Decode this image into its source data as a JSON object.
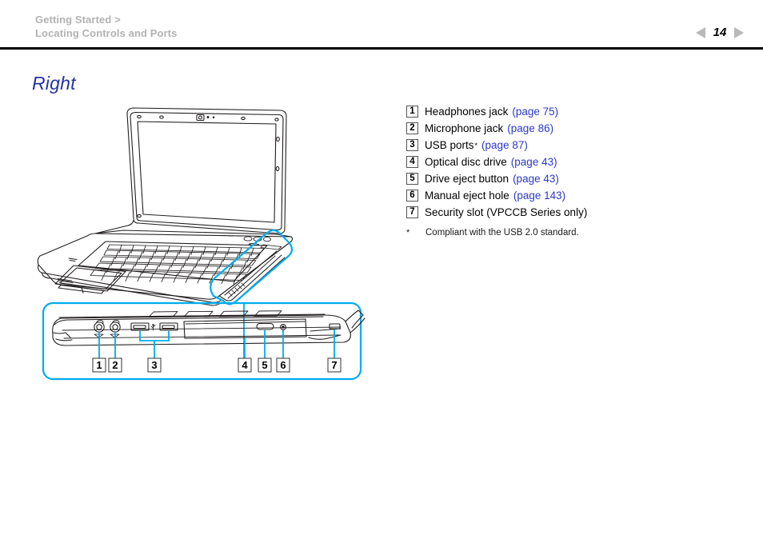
{
  "header": {
    "breadcrumb_line1": "Getting Started >",
    "breadcrumb_line2": "Locating Controls and Ports",
    "page_number": "14",
    "prev_icon": "triangle-left-icon",
    "next_icon": "triangle-right-icon"
  },
  "section": {
    "title": "Right",
    "title_color": "#2433a5"
  },
  "callouts": [
    {
      "num": "1",
      "label": "Headphones jack",
      "sup": "",
      "page": "(page 75)"
    },
    {
      "num": "2",
      "label": "Microphone jack",
      "sup": "",
      "page": "(page 86)"
    },
    {
      "num": "3",
      "label": "USB ports",
      "sup": "*",
      "page": "(page 87)"
    },
    {
      "num": "4",
      "label": "Optical disc drive",
      "sup": "",
      "page": "(page 43)"
    },
    {
      "num": "5",
      "label": "Drive eject button",
      "sup": "",
      "page": "(page 43)"
    },
    {
      "num": "6",
      "label": "Manual eject hole",
      "sup": "",
      "page": "(page 143)"
    },
    {
      "num": "7",
      "label": "Security slot (VPCCB Series only)",
      "sup": "",
      "page": ""
    }
  ],
  "footnote": {
    "mark": "*",
    "text": "Compliant with the USB 2.0 standard."
  },
  "illustration": {
    "accent_color": "#00adef",
    "line_color": "#231f20",
    "perspective_view_name": "laptop-open-perspective",
    "detail_view_name": "laptop-right-side-detail",
    "detail_callout_numbers": [
      "1",
      "2",
      "3",
      "4",
      "5",
      "6",
      "7"
    ],
    "parts": [
      "headphones-jack",
      "microphone-jack",
      "usb-port-left",
      "usb-port-right",
      "optical-disc-drive",
      "drive-eject-button",
      "manual-eject-hole",
      "security-slot"
    ]
  }
}
